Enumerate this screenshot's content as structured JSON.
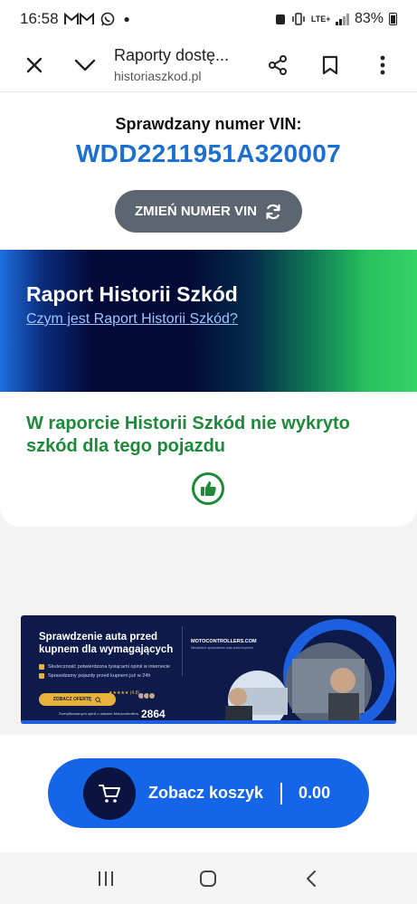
{
  "status_bar": {
    "time": "16:58",
    "app_icons": [
      "gmail-icon",
      "gmail-icon",
      "whatsapp-icon",
      "dot-icon"
    ],
    "network": "LTE+",
    "battery": "83%"
  },
  "browser": {
    "page_title": "Raporty dostę...",
    "url": "historiaszkod.pl"
  },
  "vin": {
    "label": "Sprawdzany numer VIN:",
    "number": "WDD2211951A320007",
    "change_button": "ZMIEŃ NUMER VIN"
  },
  "banner": {
    "title": "Raport Historii Szkód",
    "link": "Czym jest Raport Historii Szkód?"
  },
  "result": {
    "text": "W raporcie Historii Szkód nie wykryto szkód dla tego pojazdu",
    "icon": "thumbs-up-icon"
  },
  "ad": {
    "title": "Sprawdzenie auta przed kupnem dla wymagających",
    "point1": "Skuteczność potwierdzona tysiącami opinii w internecie",
    "point2": "Sprawdzamy pojazdy przed kupnem już w 24h",
    "offer_button": "ZOBACZ OFERTĘ",
    "rating": "★★★★★ (4.8)",
    "count_label": "Zweryfikowanych opinii o usłudze Motocontrollers",
    "count": "2864",
    "logo": "MOTOCONTROLLERS.COM",
    "logo_sub": "Niezależne sprawdzenie auta przed kupnem"
  },
  "cart": {
    "label": "Zobacz koszyk",
    "total": "0.00"
  },
  "colors": {
    "vin_blue": "#1a6fd0",
    "success_green": "#1d8a3a",
    "cart_blue": "#1565e8",
    "change_button_gray": "#5d6670"
  }
}
